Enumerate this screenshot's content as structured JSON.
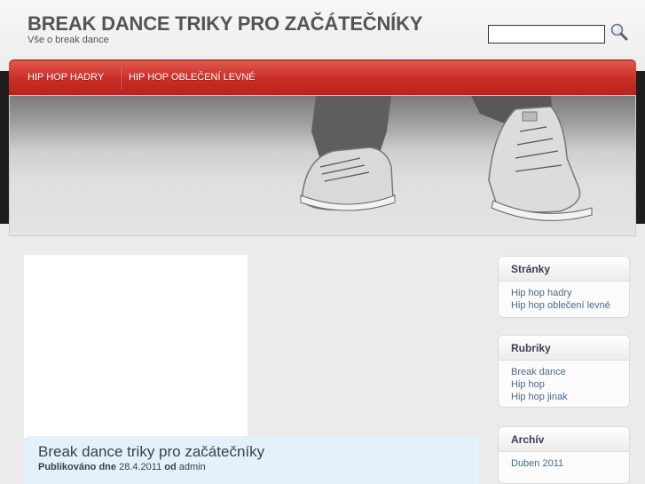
{
  "header": {
    "title": "BREAK DANCE TRIKY PRO ZAČÁTEČNÍKY",
    "description": "Vše o break dance",
    "search_placeholder": ""
  },
  "nav": {
    "items": [
      {
        "label": "HIP HOP HADRY"
      },
      {
        "label": "HIP HOP OBLEČENÍ LEVNÉ"
      }
    ]
  },
  "post": {
    "title": "Break dance triky pro začátečníky",
    "published_label": "Publikováno dne",
    "date": "28.4.2011",
    "by_label": "od",
    "author": "admin"
  },
  "sidebar": {
    "pages": {
      "title": "Stránky",
      "links": [
        "Hip hop hadry",
        "Hip hop oblečení levné"
      ]
    },
    "categories": {
      "title": "Rubriky",
      "links": [
        "Break dance",
        "Hip hop",
        "Hip hop jinak"
      ]
    },
    "archive": {
      "title": "Archív",
      "links": [
        "Duben 2011"
      ]
    }
  },
  "colors": {
    "nav_red": "#c92e26",
    "link_blue": "#4a6a8a",
    "post_bg": "#e2f1fa"
  }
}
